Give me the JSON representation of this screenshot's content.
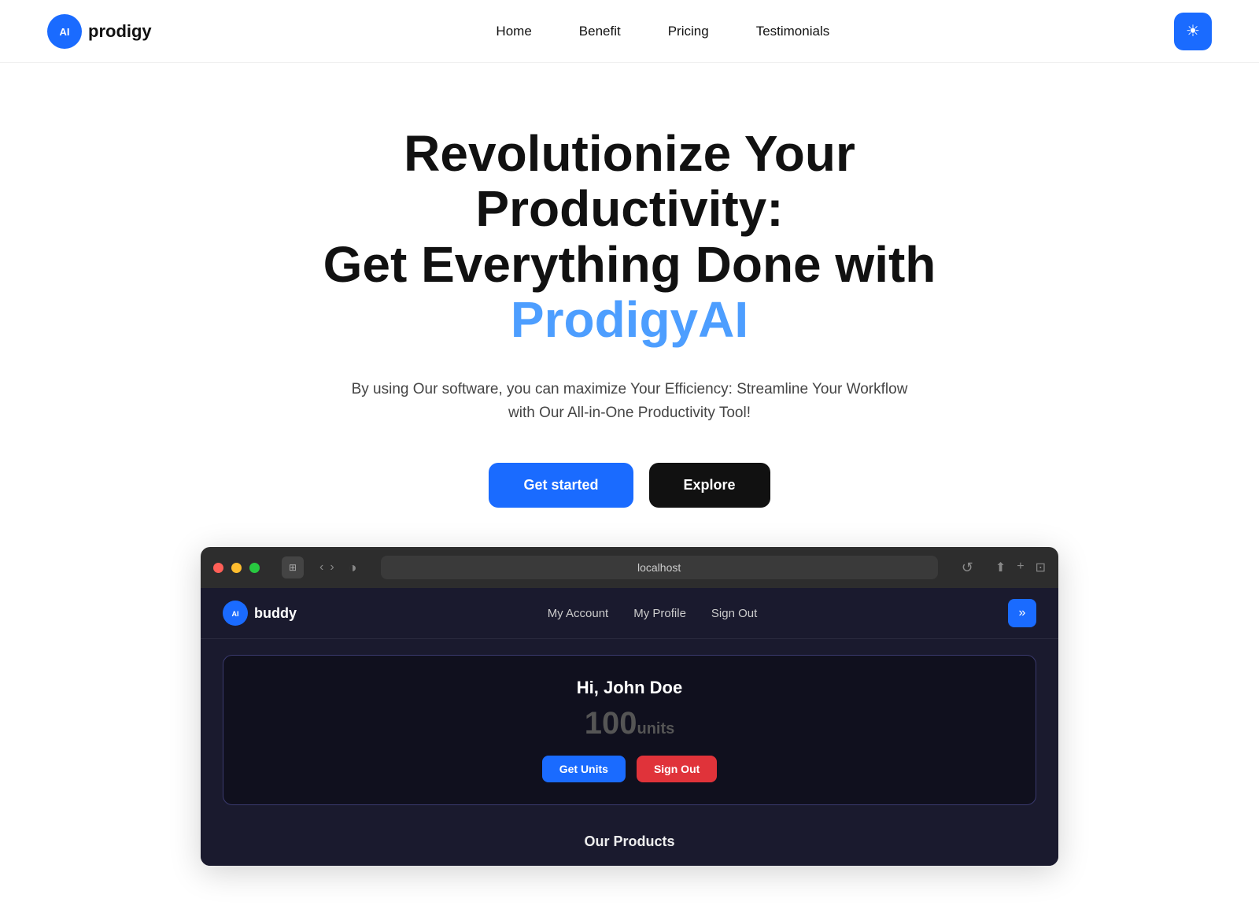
{
  "nav": {
    "logo_text": "prodigy",
    "logo_icon": "AI",
    "links": [
      "Home",
      "Benefit",
      "Pricing",
      "Testimonials"
    ],
    "theme_icon": "☀"
  },
  "hero": {
    "title_line1": "Revolutionize Your Productivity:",
    "title_line2": "Get Everything Done with",
    "brand_name": "ProdigyAI",
    "subtitle": "By using Our software, you can maximize Your Efficiency: Streamline Your Workflow with Our All-in-One Productivity Tool!",
    "btn_start": "Get started",
    "btn_explore": "Explore"
  },
  "browser": {
    "url": "localhost",
    "reload_icon": "↺"
  },
  "app": {
    "logo_icon": "AI",
    "logo_text": "buddy",
    "nav_links": [
      "My Account",
      "My Profile",
      "Sign Out"
    ],
    "theme_icon": "»",
    "card": {
      "greeting": "Hi, John Doe",
      "units_value": "100",
      "units_label": "units",
      "btn_get_units": "Get Units",
      "btn_sign_out": "Sign Out"
    },
    "our_products_title": "Our Products"
  }
}
